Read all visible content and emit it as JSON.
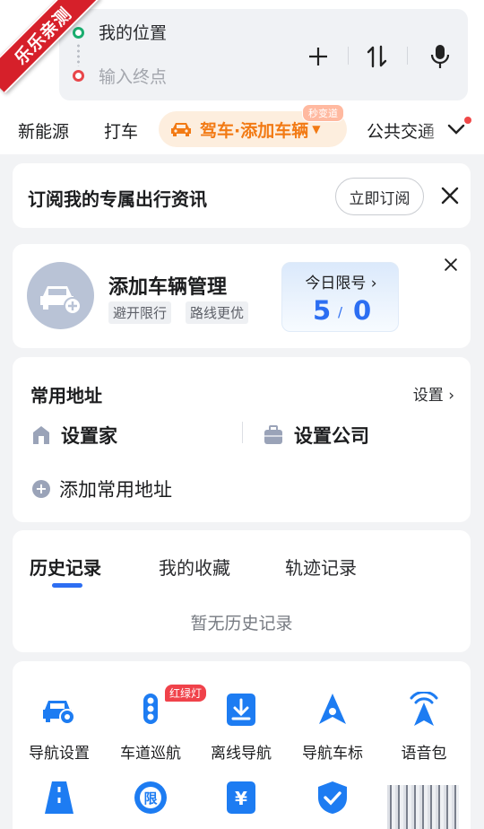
{
  "corner_badge": "乐乐亲测",
  "search": {
    "origin": "我的位置",
    "destination_placeholder": "输入终点"
  },
  "mode_tabs": [
    {
      "label": "新能源"
    },
    {
      "label": "打车"
    },
    {
      "label": "驾车·添加车辆",
      "active": true,
      "badge": "秒变道"
    },
    {
      "label": "公共交通"
    }
  ],
  "subscribe": {
    "title": "订阅我的专属出行资讯",
    "button": "立即订阅"
  },
  "vehicle": {
    "title": "添加车辆管理",
    "tags": [
      "避开限行",
      "路线更优"
    ],
    "limit_label": "今日限号",
    "limit_numbers": [
      "5",
      "0"
    ]
  },
  "addresses": {
    "title": "常用地址",
    "settings": "设置",
    "home": "设置家",
    "company": "设置公司",
    "add": "添加常用地址"
  },
  "history": {
    "tabs": [
      "历史记录",
      "我的收藏",
      "轨迹记录"
    ],
    "active_tab": 0,
    "empty_text": "暂无历史记录"
  },
  "tools": {
    "badge": "红绿灯",
    "items": [
      {
        "label": "导航设置",
        "icon": "car-settings-icon"
      },
      {
        "label": "车道巡航",
        "icon": "traffic-light-icon"
      },
      {
        "label": "离线导航",
        "icon": "download-icon"
      },
      {
        "label": "导航车标",
        "icon": "nav-arrow-icon"
      },
      {
        "label": "语音包",
        "icon": "voice-signal-icon"
      }
    ],
    "partial_row_icons": [
      "road-icon",
      "restriction-icon",
      "toll-icon",
      "shield-check-icon"
    ]
  },
  "colors": {
    "accent_blue": "#2d6ef2",
    "drive_orange": "#f27a14",
    "badge_red": "#f0424a"
  }
}
